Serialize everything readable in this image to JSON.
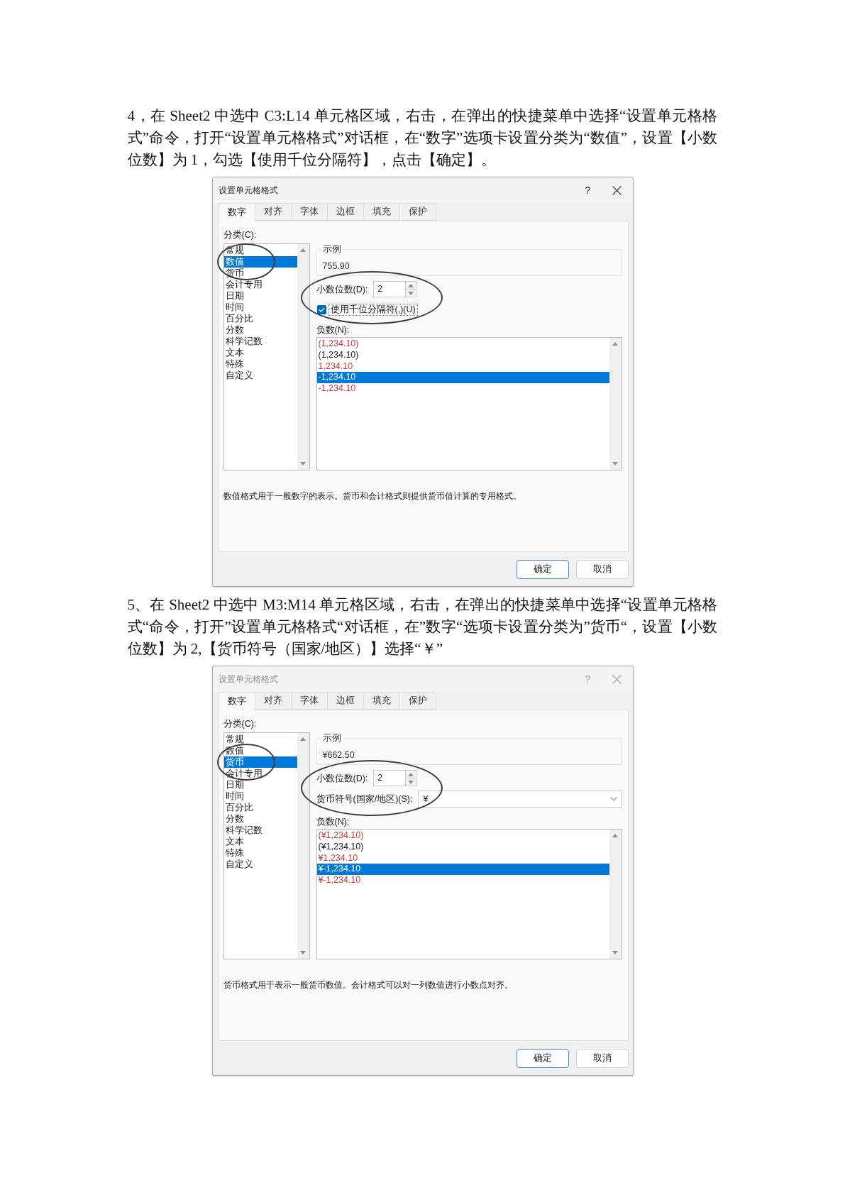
{
  "sections": [
    {
      "instruction": "4，在 Sheet2 中选中 C3:L14 单元格区域，右击，在弹出的快捷菜单中选择“设置单元格格式”命令，打开“设置单元格格式”对话框，在“数字”选项卡设置分类为“数值”，设置【小数位数】为 1，勾选【使用千位分隔符】，点击【确定】。",
      "dialog": {
        "title": "设置单元格格式",
        "active": true,
        "help": "?",
        "tabs": [
          {
            "label": "数字",
            "selected": true
          },
          {
            "label": "对齐",
            "selected": false
          },
          {
            "label": "字体",
            "selected": false
          },
          {
            "label": "边框",
            "selected": false
          },
          {
            "label": "填充",
            "selected": false
          },
          {
            "label": "保护",
            "selected": false
          }
        ],
        "category_label": "分类(C):",
        "categories": [
          {
            "label": "常规",
            "selected": false,
            "circled": false
          },
          {
            "label": "数值",
            "selected": true,
            "circled": true
          },
          {
            "label": "货币",
            "selected": false,
            "circled": false
          },
          {
            "label": "会计专用",
            "selected": false,
            "circled": false
          },
          {
            "label": "日期",
            "selected": false,
            "circled": false
          },
          {
            "label": "时间",
            "selected": false,
            "circled": false
          },
          {
            "label": "百分比",
            "selected": false,
            "circled": false
          },
          {
            "label": "分数",
            "selected": false,
            "circled": false
          },
          {
            "label": "科学记数",
            "selected": false,
            "circled": false
          },
          {
            "label": "文本",
            "selected": false,
            "circled": false
          },
          {
            "label": "特殊",
            "selected": false,
            "circled": false
          },
          {
            "label": "自定义",
            "selected": false,
            "circled": false
          }
        ],
        "sample": {
          "label": "示例",
          "value": "755.90"
        },
        "options_circled": true,
        "fields": [
          {
            "kind": "spin",
            "label": "小数位数(D):",
            "value": "2"
          },
          {
            "kind": "checkbox",
            "label": "使用千位分隔符(,)(U)",
            "checked": true
          }
        ],
        "negatives_label": "负数(N):",
        "negatives": [
          {
            "label": "(1,234.10)",
            "in_red": true,
            "selected": false
          },
          {
            "label": "(1,234.10)",
            "in_red": false,
            "selected": false
          },
          {
            "label": "1,234.10",
            "in_red": true,
            "selected": false
          },
          {
            "label": "-1,234.10",
            "in_red": false,
            "selected": true
          },
          {
            "label": "-1,234.10",
            "in_red": true,
            "selected": false
          }
        ],
        "description": "数值格式用于一般数字的表示。货币和会计格式则提供货币值计算的专用格式。",
        "buttons": [
          {
            "label": "确定",
            "default": true
          },
          {
            "label": "取消",
            "default": false
          }
        ]
      }
    },
    {
      "instruction": "5、在 Sheet2 中选中 M3:M14 单元格区域，右击，在弹出的快捷菜单中选择“设置单元格格式“命令，打开”设置单元格格式“对话框，在”数字“选项卡设置分类为”货币“，设置【小数位数】为 2,【货币符号（国家/地区）】选择“￥”",
      "dialog": {
        "title": "设置单元格格式",
        "active": false,
        "help": "?",
        "tabs": [
          {
            "label": "数字",
            "selected": true
          },
          {
            "label": "对齐",
            "selected": false
          },
          {
            "label": "字体",
            "selected": false
          },
          {
            "label": "边框",
            "selected": false
          },
          {
            "label": "填充",
            "selected": false
          },
          {
            "label": "保护",
            "selected": false
          }
        ],
        "category_label": "分类(C):",
        "categories": [
          {
            "label": "常规",
            "selected": false,
            "circled": false
          },
          {
            "label": "数值",
            "selected": false,
            "circled": false
          },
          {
            "label": "货币",
            "selected": true,
            "circled": true
          },
          {
            "label": "会计专用",
            "selected": false,
            "circled": false
          },
          {
            "label": "日期",
            "selected": false,
            "circled": false
          },
          {
            "label": "时间",
            "selected": false,
            "circled": false
          },
          {
            "label": "百分比",
            "selected": false,
            "circled": false
          },
          {
            "label": "分数",
            "selected": false,
            "circled": false
          },
          {
            "label": "科学记数",
            "selected": false,
            "circled": false
          },
          {
            "label": "文本",
            "selected": false,
            "circled": false
          },
          {
            "label": "特殊",
            "selected": false,
            "circled": false
          },
          {
            "label": "自定义",
            "selected": false,
            "circled": false
          }
        ],
        "sample": {
          "label": "示例",
          "value": "¥662.50"
        },
        "options_circled": true,
        "fields": [
          {
            "kind": "spin",
            "label": "小数位数(D):",
            "value": "2"
          },
          {
            "kind": "dropdown",
            "label": "货币符号(国家/地区)(S):",
            "value": "¥"
          }
        ],
        "negatives_label": "负数(N):",
        "negatives": [
          {
            "label": "(¥1,234.10)",
            "in_red": true,
            "selected": false
          },
          {
            "label": "(¥1,234.10)",
            "in_red": false,
            "selected": false
          },
          {
            "label": "¥1,234.10",
            "in_red": true,
            "selected": false
          },
          {
            "label": "¥-1,234.10",
            "in_red": false,
            "selected": true
          },
          {
            "label": "¥-1,234.10",
            "in_red": true,
            "selected": false
          }
        ],
        "description": "货币格式用于表示一般货币数值。会计格式可以对一列数值进行小数点对齐。",
        "buttons": [
          {
            "label": "确定",
            "default": true
          },
          {
            "label": "取消",
            "default": false
          }
        ]
      }
    }
  ]
}
